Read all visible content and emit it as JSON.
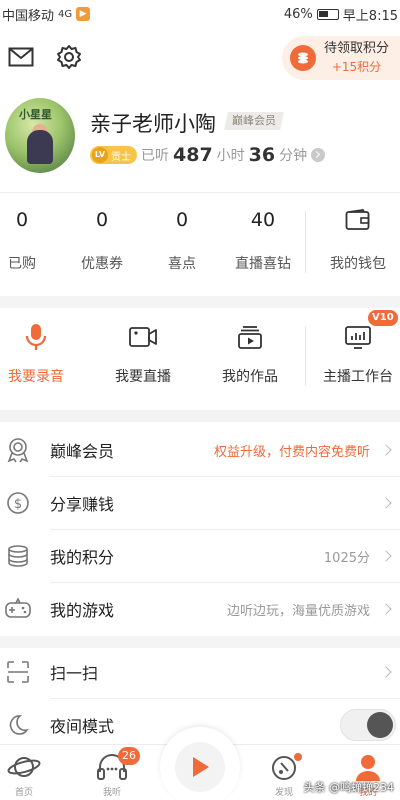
{
  "status_bar": {
    "carrier": "中国移动",
    "signal_text": "4G",
    "battery": "46%",
    "time": "早上8:15"
  },
  "header": {
    "mail_icon": "mail-icon",
    "settings_icon": "gear-icon",
    "points_title": "待领取积分",
    "points_value": "+15积分"
  },
  "profile": {
    "avatar_caption": "小星星",
    "name": "亲子老师小陶",
    "vip_tag": "巅峰会员",
    "level_prefix": "LV",
    "level_title": "贡士",
    "listened_label": "已听",
    "hours": "487",
    "hours_unit": "小时",
    "minutes": "36",
    "minutes_unit": "分钟"
  },
  "stats": [
    {
      "value": "0",
      "label": "已购"
    },
    {
      "value": "0",
      "label": "优惠券"
    },
    {
      "value": "0",
      "label": "喜点"
    },
    {
      "value": "40",
      "label": "直播喜钻"
    }
  ],
  "wallet": {
    "label": "我的钱包",
    "icon": "wallet-icon"
  },
  "actions": [
    {
      "label": "我要录音",
      "icon": "microphone-icon"
    },
    {
      "label": "我要直播",
      "icon": "video-camera-icon"
    },
    {
      "label": "我的作品",
      "icon": "works-icon"
    },
    {
      "label": "主播工作台",
      "icon": "studio-icon",
      "badge": "V10"
    }
  ],
  "menu": [
    {
      "label": "巅峰会员",
      "value": "权益升级，付费内容免费听",
      "icon": "medal-icon"
    },
    {
      "label": "分享赚钱",
      "value": "",
      "icon": "dollar-icon"
    },
    {
      "label": "我的积分",
      "value": "1025分",
      "icon": "coins-icon"
    },
    {
      "label": "我的游戏",
      "value": "边听边玩，海量优质游戏",
      "icon": "gamepad-icon"
    },
    {
      "label": "扫一扫",
      "value": "",
      "icon": "scan-icon"
    },
    {
      "label": "夜间模式",
      "value": "",
      "icon": "moon-icon"
    }
  ],
  "bottom_nav": [
    {
      "label": "首页",
      "icon": "planet-icon"
    },
    {
      "label": "我听",
      "icon": "headphones-icon",
      "badge": "26"
    },
    {
      "label": "发现",
      "icon": "discover-icon"
    },
    {
      "label": "我的",
      "icon": "person-icon"
    }
  ],
  "watermark": "头条 @鸣蝉蝉234",
  "colors": {
    "accent": "#f06a3a",
    "vip_gold": "#f5c44a"
  }
}
